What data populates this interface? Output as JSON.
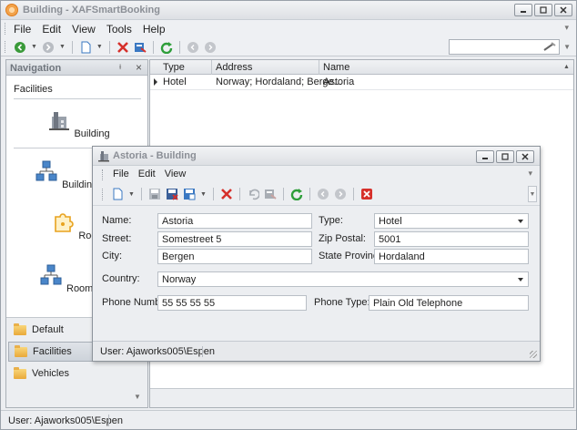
{
  "window": {
    "title": "Building - XAFSmartBooking"
  },
  "menu": {
    "items": [
      "File",
      "Edit",
      "View",
      "Tools",
      "Help"
    ]
  },
  "navigation": {
    "title": "Navigation",
    "group": "Facilities",
    "items": [
      "Building",
      "Building Type",
      "Room",
      "Room Type"
    ],
    "bottom_groups": [
      "Default",
      "Facilities",
      "Vehicles"
    ]
  },
  "grid": {
    "columns": [
      "Type",
      "Address",
      "Name"
    ],
    "rows": [
      {
        "type": "Hotel",
        "address": "Norway; Hordaland; Berge...",
        "name": "Astoria"
      }
    ]
  },
  "status": {
    "user": "User: Ajaworks005\\Espen"
  },
  "detail": {
    "title": "Astoria - Building",
    "menu": [
      "File",
      "Edit",
      "View"
    ],
    "labels": {
      "name": "Name:",
      "street": "Street:",
      "city": "City:",
      "country": "Country:",
      "phone_number": "Phone Number:",
      "type": "Type:",
      "zip": "Zip Postal:",
      "state": "State Province:",
      "phone_type": "Phone Type:"
    },
    "values": {
      "name": "Astoria",
      "street": "Somestreet 5",
      "city": "Bergen",
      "country": "Norway",
      "phone_number": "55 55 55 55",
      "type": "Hotel",
      "zip": "5001",
      "state": "Hordaland",
      "phone_type": "Plain Old Telephone"
    },
    "status": "User: Ajaworks005\\Espen"
  }
}
